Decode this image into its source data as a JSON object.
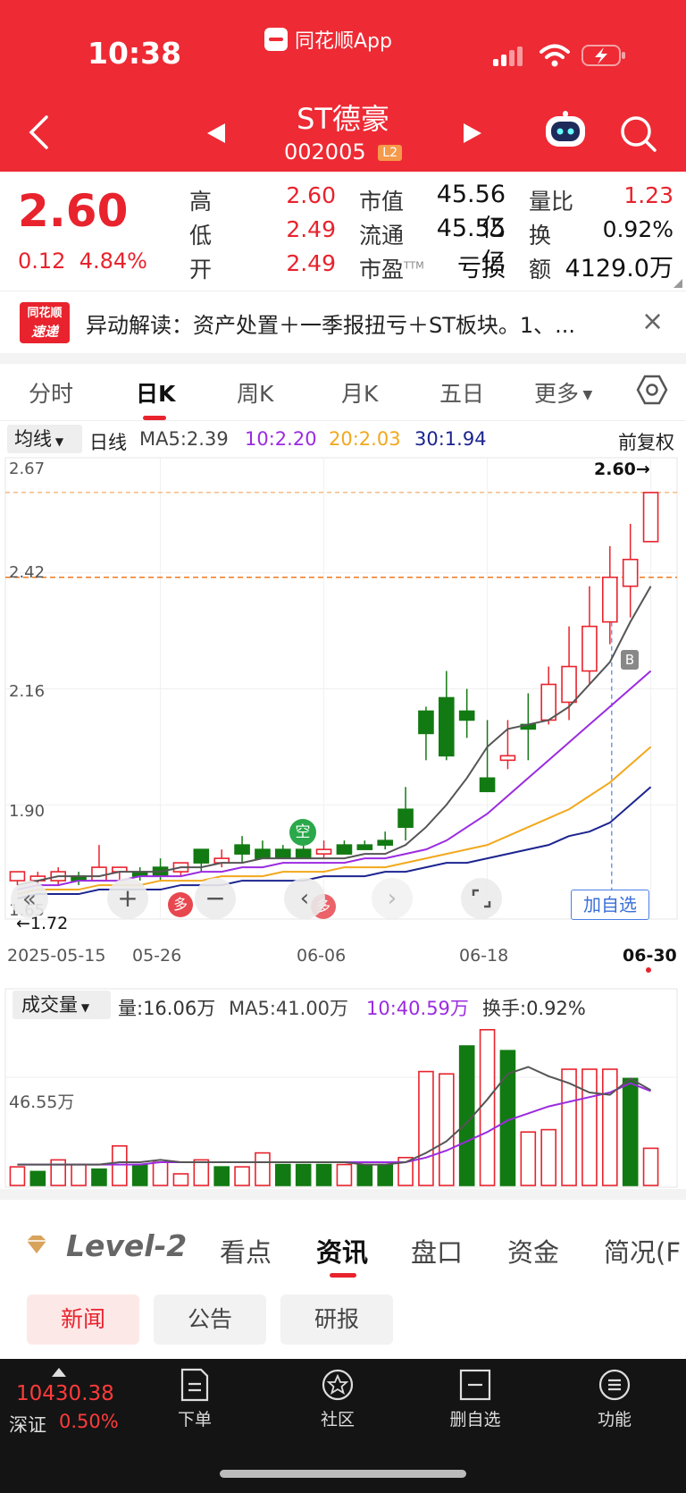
{
  "status_bar": {
    "time": "10:38",
    "app_label": "同花顺App"
  },
  "header": {
    "stock_name": "ST德豪",
    "stock_code": "002005",
    "badge": "L2"
  },
  "quote": {
    "price": "2.60",
    "change": "0.12",
    "change_pct": "4.84%",
    "high_label": "高",
    "high": "2.60",
    "low_label": "低",
    "low": "2.49",
    "open_label": "开",
    "open": "2.49",
    "mcap_label": "市值",
    "mcap": "45.56亿",
    "float_label": "流通",
    "float": "45.55亿",
    "pe_label": "市盈",
    "pe_sup": "TTM",
    "pe": "亏损",
    "vr_label": "量比",
    "vr": "1.23",
    "turnover_label": "换",
    "turnover": "0.92%",
    "amount_label": "额",
    "amount": "4129.0万"
  },
  "news": {
    "logo_line1": "同花顺",
    "logo_line2": "速递",
    "text": "异动解读：资产处置＋一季报扭亏＋ST板块。1、..."
  },
  "period_tabs": [
    "分时",
    "日K",
    "周K",
    "月K",
    "五日",
    "更多"
  ],
  "ma": {
    "select": "均线",
    "line_type": "日线",
    "ma5": "MA5:2.39",
    "ma10": "10:2.20",
    "ma20": "20:2.03",
    "ma30": "30:1.94",
    "adjust": "前复权"
  },
  "chart_labels": {
    "max_tag": "2.60→",
    "min_tag": "←1.72",
    "y_ticks": [
      "2.67",
      "2.42",
      "2.16",
      "1.90",
      "1.65"
    ],
    "kong": "空",
    "duo": "多",
    "b_tag": "B",
    "add_watch": "加自选",
    "dates": [
      "2025-05-15",
      "05-26",
      "06-06",
      "06-18",
      "06-30"
    ]
  },
  "volume": {
    "select": "成交量",
    "vol": "量:16.06万",
    "ma5": "MA5:41.00万",
    "ma10": "10:40.59万",
    "turn": "换手:0.92%",
    "y_tick": "46.55万"
  },
  "bottom_tabs": {
    "level2": "Level-2",
    "items": [
      "看点",
      "资讯",
      "盘口",
      "资金",
      "简况(F"
    ]
  },
  "sub_tabs": [
    "新闻",
    "公告",
    "研报"
  ],
  "footer": {
    "index_price": "10430.38",
    "index_name": "深证",
    "index_change": "0.50%",
    "items": [
      "下单",
      "社区",
      "删自选",
      "功能"
    ]
  },
  "colors": {
    "up": "#e8232d",
    "down": "#127a12",
    "brand": "#ee2a34",
    "ma5": "#555555",
    "ma10": "#9b2be0",
    "ma20": "#f2a81d",
    "ma30": "#1c2490"
  },
  "chart_data": {
    "type": "candlestick",
    "x": [
      "05-15",
      "05-16",
      "05-19",
      "05-20",
      "05-21",
      "05-22",
      "05-23",
      "05-26",
      "05-27",
      "05-28",
      "05-29",
      "05-30",
      "06-03",
      "06-04",
      "06-05",
      "06-06",
      "06-09",
      "06-10",
      "06-11",
      "06-12",
      "06-13",
      "06-16",
      "06-17",
      "06-18",
      "06-19",
      "06-20",
      "06-23",
      "06-24",
      "06-25",
      "06-26",
      "06-27",
      "06-30"
    ],
    "open": [
      1.73,
      1.73,
      1.73,
      1.74,
      1.73,
      1.75,
      1.75,
      1.76,
      1.75,
      1.8,
      1.77,
      1.81,
      1.8,
      1.8,
      1.8,
      1.79,
      1.81,
      1.81,
      1.82,
      1.89,
      2.11,
      2.14,
      2.11,
      1.96,
      2.0,
      2.08,
      2.09,
      2.13,
      2.2,
      2.31,
      2.39,
      2.49
    ],
    "high": [
      1.74,
      1.75,
      1.76,
      1.75,
      1.81,
      1.76,
      1.76,
      1.78,
      1.77,
      1.8,
      1.8,
      1.83,
      1.82,
      1.81,
      1.81,
      1.82,
      1.82,
      1.82,
      1.84,
      1.94,
      2.12,
      2.2,
      2.16,
      2.09,
      2.09,
      2.15,
      2.21,
      2.3,
      2.39,
      2.48,
      2.53,
      2.6
    ],
    "low": [
      1.72,
      1.72,
      1.72,
      1.72,
      1.73,
      1.73,
      1.73,
      1.73,
      1.74,
      1.75,
      1.76,
      1.77,
      1.78,
      1.78,
      1.78,
      1.78,
      1.79,
      1.8,
      1.8,
      1.82,
      2.0,
      2.0,
      2.05,
      1.96,
      1.98,
      2.0,
      2.08,
      2.09,
      2.17,
      2.26,
      2.32,
      2.49
    ],
    "close": [
      1.75,
      1.74,
      1.75,
      1.73,
      1.76,
      1.76,
      1.74,
      1.74,
      1.77,
      1.77,
      1.78,
      1.79,
      1.78,
      1.78,
      1.78,
      1.8,
      1.79,
      1.8,
      1.81,
      1.85,
      2.06,
      2.01,
      2.09,
      1.93,
      2.01,
      2.07,
      2.17,
      2.21,
      2.3,
      2.41,
      2.45,
      2.6
    ],
    "ma5": [
      1.72,
      1.73,
      1.74,
      1.74,
      1.74,
      1.75,
      1.75,
      1.75,
      1.76,
      1.76,
      1.77,
      1.77,
      1.78,
      1.78,
      1.78,
      1.78,
      1.78,
      1.79,
      1.79,
      1.81,
      1.85,
      1.9,
      1.96,
      2.03,
      2.07,
      2.08,
      2.09,
      2.12,
      2.17,
      2.22,
      2.31,
      2.39
    ],
    "ma10": [
      1.71,
      1.72,
      1.72,
      1.73,
      1.73,
      1.73,
      1.74,
      1.74,
      1.74,
      1.75,
      1.75,
      1.76,
      1.76,
      1.77,
      1.77,
      1.77,
      1.77,
      1.78,
      1.78,
      1.79,
      1.8,
      1.82,
      1.85,
      1.88,
      1.92,
      1.96,
      2.0,
      2.04,
      2.08,
      2.12,
      2.16,
      2.2
    ],
    "ma20": [
      1.7,
      1.71,
      1.71,
      1.71,
      1.72,
      1.72,
      1.72,
      1.73,
      1.73,
      1.73,
      1.74,
      1.74,
      1.74,
      1.75,
      1.75,
      1.75,
      1.76,
      1.76,
      1.76,
      1.77,
      1.78,
      1.79,
      1.8,
      1.81,
      1.83,
      1.85,
      1.87,
      1.89,
      1.92,
      1.95,
      1.99,
      2.03
    ],
    "ma30": [
      1.69,
      1.7,
      1.7,
      1.7,
      1.71,
      1.71,
      1.71,
      1.71,
      1.72,
      1.72,
      1.72,
      1.73,
      1.73,
      1.73,
      1.73,
      1.74,
      1.74,
      1.74,
      1.75,
      1.75,
      1.76,
      1.77,
      1.77,
      1.78,
      1.79,
      1.8,
      1.81,
      1.83,
      1.84,
      1.86,
      1.9,
      1.94
    ],
    "volume": [
      8,
      6,
      11,
      9,
      7,
      17,
      9,
      10,
      5,
      11,
      8,
      8,
      14,
      9,
      9,
      9,
      9,
      9,
      9,
      12,
      49,
      48,
      60,
      67,
      58,
      23,
      24,
      50,
      50,
      50,
      46,
      16
    ],
    "volume_up": [
      true,
      false,
      true,
      true,
      false,
      true,
      false,
      true,
      true,
      true,
      false,
      true,
      true,
      false,
      false,
      false,
      true,
      false,
      false,
      true,
      true,
      true,
      false,
      true,
      false,
      true,
      true,
      true,
      true,
      true,
      false,
      true
    ],
    "vol_ma5": [
      9,
      9,
      9,
      9,
      9,
      10,
      10,
      11,
      10,
      10,
      10,
      10,
      10,
      10,
      10,
      10,
      10,
      9,
      9,
      10,
      14,
      19,
      27,
      37,
      48,
      51,
      47,
      44,
      40,
      39,
      46,
      41
    ],
    "vol_ma10": [
      9,
      9,
      9,
      9,
      9,
      9,
      9,
      10,
      10,
      10,
      10,
      10,
      10,
      10,
      10,
      10,
      10,
      10,
      10,
      10,
      12,
      15,
      19,
      23,
      28,
      31,
      34,
      36,
      38,
      40,
      44,
      40.6
    ],
    "ylim": [
      1.65,
      2.67
    ],
    "vol_ylim": [
      0,
      70
    ]
  }
}
